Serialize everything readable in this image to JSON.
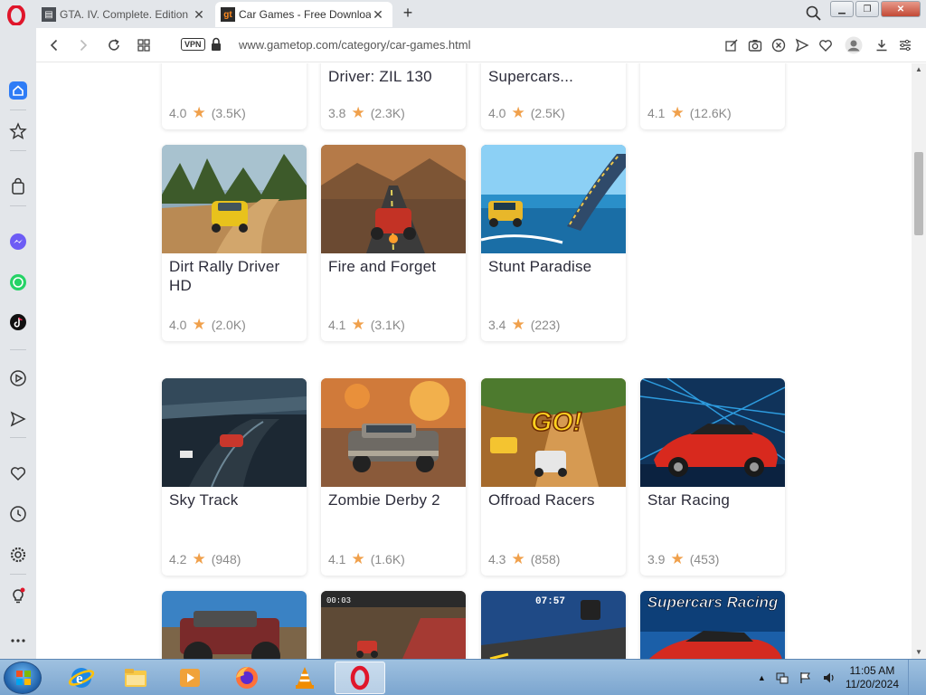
{
  "browser": {
    "tabs": [
      {
        "title": "GTA. IV. Complete. Edition",
        "favicon": "gta",
        "active": false
      },
      {
        "title": "Car Games - Free Downloa",
        "favicon": "gt",
        "active": true
      }
    ],
    "url": "www.gametop.com/category/car-games.html",
    "vpn_label": "VPN"
  },
  "cards": [
    {
      "name": "",
      "rating": "4.0",
      "count": "(3.5K)"
    },
    {
      "name": "Driver: ZIL 130",
      "rating": "3.8",
      "count": "(2.3K)"
    },
    {
      "name": "Supercars...",
      "rating": "4.0",
      "count": "(2.5K)"
    },
    {
      "name": "",
      "rating": "4.1",
      "count": "(12.6K)"
    },
    {
      "name": "Dirt Rally Driver HD",
      "rating": "4.0",
      "count": "(2.0K)"
    },
    {
      "name": "Fire and Forget",
      "rating": "4.1",
      "count": "(3.1K)"
    },
    {
      "name": "Stunt Paradise",
      "rating": "3.4",
      "count": "(223)"
    },
    {
      "name": "Sky Track",
      "rating": "4.2",
      "count": "(948)"
    },
    {
      "name": "Zombie Derby 2",
      "rating": "4.1",
      "count": "(1.6K)"
    },
    {
      "name": "Offroad Racers",
      "rating": "4.3",
      "count": "(858)"
    },
    {
      "name": "Star Racing",
      "rating": "3.9",
      "count": "(453)"
    }
  ],
  "thumb_text": {
    "offroad": "GO!",
    "supercars": "Supercars Racing",
    "timer1": "00:03",
    "timer2": "07:57"
  },
  "taskbar": {
    "time": "11:05 AM",
    "date": "11/20/2024"
  },
  "colors": {
    "star": "#f0a04b",
    "opera_red": "#e0162b",
    "sidebar_bg": "#e3e6ea",
    "accent_blue": "#2e7cf6"
  }
}
